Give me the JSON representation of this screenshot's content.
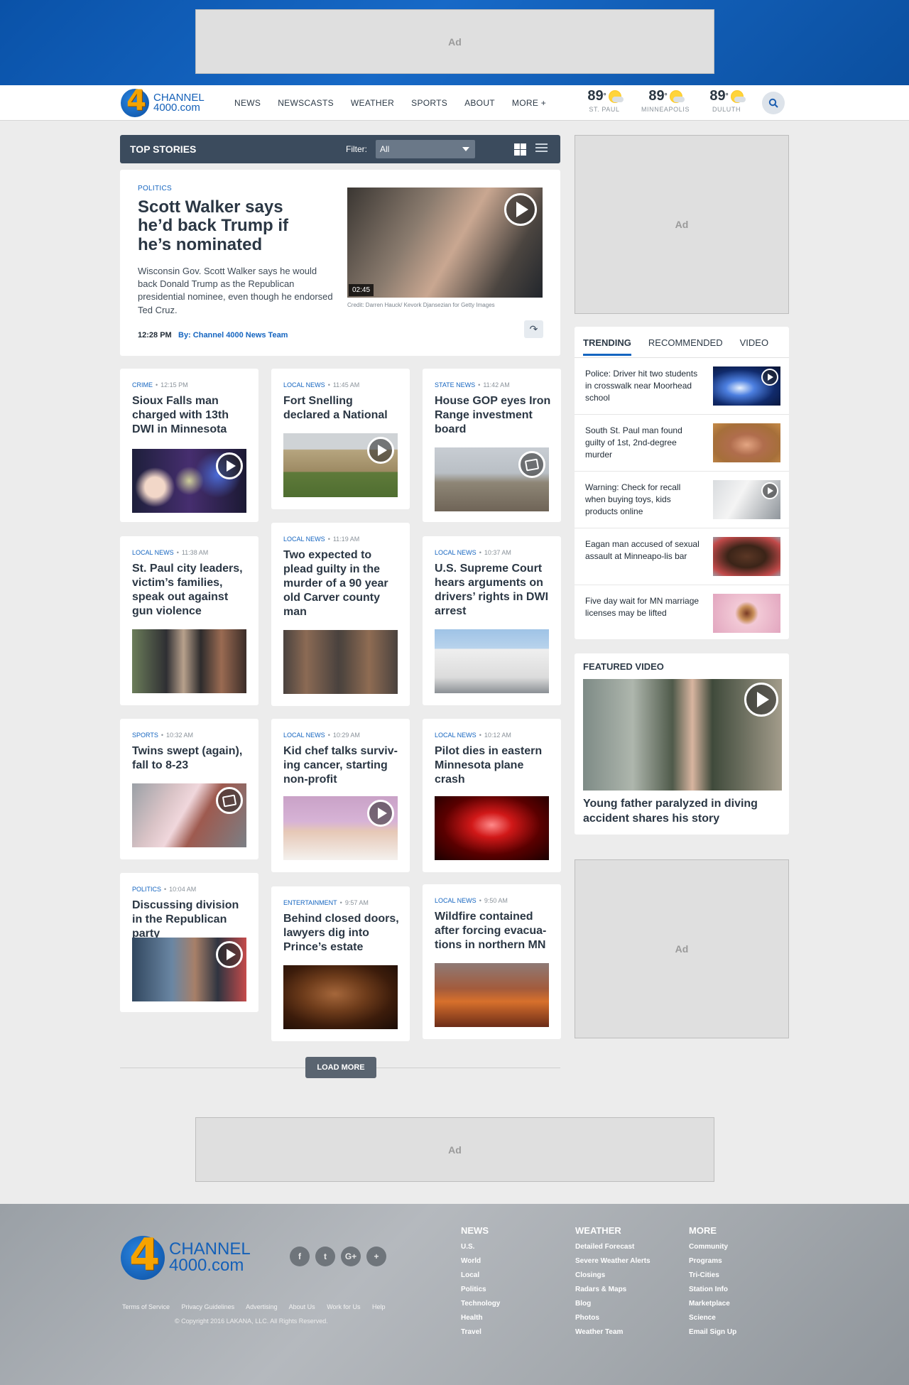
{
  "ads": {
    "label": "Ad"
  },
  "header": {
    "logo_line1": "CHANNEL",
    "logo_line2": "4000.com",
    "logo_mark": "4",
    "nav": [
      "NEWS",
      "NEWSCASTS",
      "WEATHER",
      "SPORTS",
      "ABOUT",
      "MORE +"
    ],
    "weather": [
      {
        "temp": "89",
        "deg": "°",
        "city": "ST. PAUL",
        "icon": "partly-sunny-icon"
      },
      {
        "temp": "89",
        "deg": "°",
        "city": "MINNEAPOLIS",
        "icon": "partly-sunny-icon"
      },
      {
        "temp": "89",
        "deg": "°",
        "city": "DULUTH",
        "icon": "partly-sunny-icon"
      }
    ],
    "search_icon": "search-icon"
  },
  "top_stories": {
    "title": "TOP STORIES",
    "filter_label": "Filter:",
    "filter_value": "All"
  },
  "feature": {
    "category": "POLITICS",
    "headline": "Scott Walker says he’d back Trump if he’s nominated",
    "dek": "Wisconsin Gov. Scott Walker says he would back Donald Trump as the Republican presidential nominee, even though he endorsed Ted Cruz.",
    "time": "12:28 PM",
    "byline": "By: Channel 4000 News Team",
    "duration": "02:45",
    "credit": "Credit: Darren Hauck/ Kevork Djansezian for Getty Images"
  },
  "stories": [
    {
      "category": "CRIME",
      "time": "12:15 PM",
      "title": "Sioux Falls man charged with 13th DWI in Minnesota",
      "media": "video"
    },
    {
      "category": "LOCAL NEWS",
      "time": "11:45 AM",
      "title": "Fort Snelling declared a National",
      "media": "video"
    },
    {
      "category": "STATE NEWS",
      "time": "11:42 AM",
      "title": "House GOP eyes Iron Range investment board",
      "media": "gallery"
    },
    {
      "category": "LOCAL NEWS",
      "time": "11:38 AM",
      "title": "St. Paul city leaders, victim’s families, speak out against gun violence",
      "media": "none"
    },
    {
      "category": "LOCAL NEWS",
      "time": "11:19 AM",
      "title": "Two expected to plead guilty in the murder of a 90 year old Carver county man",
      "media": "none"
    },
    {
      "category": "LOCAL NEWS",
      "time": "10:37 AM",
      "title": "U.S. Supreme Court hears arguments on drivers’ rights in DWI arrest",
      "media": "none"
    },
    {
      "category": "SPORTS",
      "time": "10:32 AM",
      "title": "Twins swept (again), fall to 8-23",
      "media": "gallery"
    },
    {
      "category": "LOCAL NEWS",
      "time": "10:29 AM",
      "title": "Kid chef talks surviv-ing cancer, starting non-profit",
      "media": "video"
    },
    {
      "category": "LOCAL NEWS",
      "time": "10:12 AM",
      "title": "Pilot dies in eastern Minnesota plane crash",
      "media": "none"
    },
    {
      "category": "POLITICS",
      "time": "10:04 AM",
      "title": "Discussing division in the Republican party",
      "media": "video"
    },
    {
      "category": "ENTERTAINMENT",
      "time": "9:57 AM",
      "title": "Behind closed doors, lawyers dig into Prince’s estate",
      "media": "none"
    },
    {
      "category": "LOCAL NEWS",
      "time": "9:50 AM",
      "title": "Wildfire contained after forcing evacua-tions in northern MN",
      "media": "none"
    }
  ],
  "load_more": "LOAD MORE",
  "trending": {
    "tabs": [
      "TRENDING",
      "RECOMMENDED",
      "VIDEO"
    ],
    "items": [
      {
        "text": "Police: Driver hit two students in crosswalk near Moorhead school",
        "video": true
      },
      {
        "text": "South St. Paul man found guilty of 1st, 2nd-degree murder",
        "video": false
      },
      {
        "text": "Warning: Check for recall when buying toys, kids products online",
        "video": true
      },
      {
        "text": "Eagan man accused of sexual assault at Minneapo-lis bar",
        "video": false
      },
      {
        "text": "Five day wait for MN marriage licenses may be lifted",
        "video": false
      }
    ]
  },
  "featured_video": {
    "label": "FEATURED VIDEO",
    "title": "Young father paralyzed in diving accident shares his story"
  },
  "footer": {
    "socials": [
      "f",
      "t",
      "G+",
      "+"
    ],
    "links": [
      "Terms of Service",
      "Privacy Guidelines",
      "Advertising",
      "About Us",
      "Work for Us",
      "Help"
    ],
    "copyright": "© Copyright 2016 LAKANA, LLC. All Rights Reserved.",
    "columns": [
      {
        "heading": "NEWS",
        "links": [
          "U.S.",
          "World",
          "Local",
          "Politics",
          "Technology",
          "Health",
          "Travel"
        ]
      },
      {
        "heading": "WEATHER",
        "links": [
          "Detailed Forecast",
          "Severe Weather Alerts",
          "Closings",
          "Radars & Maps",
          "Blog",
          "Photos",
          "Weather Team"
        ]
      },
      {
        "heading": "MORE",
        "links": [
          "Community",
          "Programs",
          "Tri-Cities",
          "Station Info",
          "Marketplace",
          "Science",
          "Email Sign Up"
        ]
      }
    ]
  },
  "colors": {
    "brand_blue": "#1565c0",
    "header_bar": "#3b4b5d",
    "logo_orange": "#f5a300"
  }
}
